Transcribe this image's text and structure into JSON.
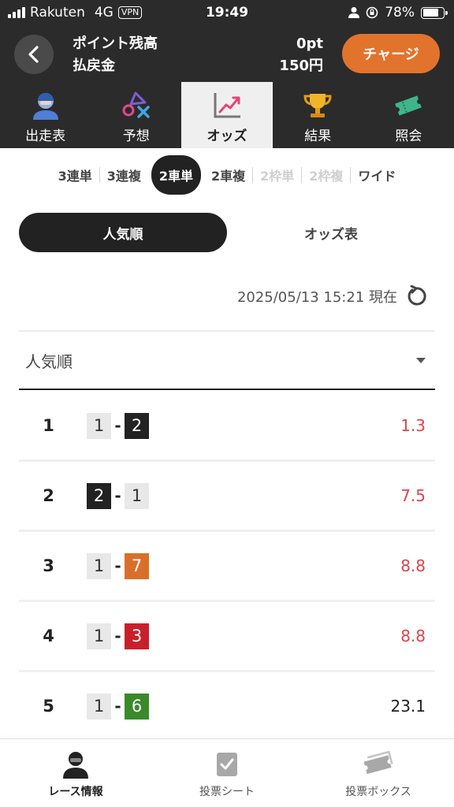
{
  "status_bar": {
    "carrier": "Rakuten",
    "network": "4G",
    "vpn": "VPN",
    "time": "19:49",
    "battery": "78%",
    "battery_level": 0.78
  },
  "header": {
    "point_label": "ポイント残高",
    "point_value": "0pt",
    "refund_label": "払戻金",
    "refund_value": "150円",
    "charge_button": "チャージ"
  },
  "main_tabs": [
    {
      "label": "出走表",
      "icon": "racer-icon",
      "active": false
    },
    {
      "label": "予想",
      "icon": "prediction-icon",
      "active": false
    },
    {
      "label": "オッズ",
      "icon": "odds-chart-icon",
      "active": true
    },
    {
      "label": "結果",
      "icon": "trophy-icon",
      "active": false
    },
    {
      "label": "照会",
      "icon": "ticket-icon",
      "active": false
    }
  ],
  "bet_types": [
    {
      "label": "3連単",
      "state": "normal"
    },
    {
      "label": "3連複",
      "state": "normal"
    },
    {
      "label": "2車単",
      "state": "active"
    },
    {
      "label": "2車複",
      "state": "normal"
    },
    {
      "label": "2枠単",
      "state": "disabled"
    },
    {
      "label": "2枠複",
      "state": "disabled"
    },
    {
      "label": "ワイド",
      "state": "normal"
    }
  ],
  "view_toggle": {
    "popularity": "人気順",
    "odds_table": "オッズ表",
    "active": "popularity"
  },
  "timestamp": "2025/05/13 15:21 現在",
  "sort_select": {
    "value": "人気順"
  },
  "colors": {
    "accent_orange": "#e2732c",
    "header_dark": "#2b2b2b",
    "odds_red": "#e0424a",
    "odds_normal": "#222222"
  },
  "odds_rows": [
    {
      "rank": "1",
      "first": {
        "num": "1",
        "bg": "#e8e8e8",
        "fg": "#333333"
      },
      "second": {
        "num": "2",
        "bg": "#222222",
        "fg": "#ffffff"
      },
      "odds": "1.3",
      "highlight": true
    },
    {
      "rank": "2",
      "first": {
        "num": "2",
        "bg": "#222222",
        "fg": "#ffffff"
      },
      "second": {
        "num": "1",
        "bg": "#e8e8e8",
        "fg": "#333333"
      },
      "odds": "7.5",
      "highlight": true
    },
    {
      "rank": "3",
      "first": {
        "num": "1",
        "bg": "#e8e8e8",
        "fg": "#333333"
      },
      "second": {
        "num": "7",
        "bg": "#d9702a",
        "fg": "#ffffff"
      },
      "odds": "8.8",
      "highlight": true
    },
    {
      "rank": "4",
      "first": {
        "num": "1",
        "bg": "#e8e8e8",
        "fg": "#333333"
      },
      "second": {
        "num": "3",
        "bg": "#c8202a",
        "fg": "#ffffff"
      },
      "odds": "8.8",
      "highlight": true
    },
    {
      "rank": "5",
      "first": {
        "num": "1",
        "bg": "#e8e8e8",
        "fg": "#333333"
      },
      "second": {
        "num": "6",
        "bg": "#3a8a2a",
        "fg": "#ffffff"
      },
      "odds": "23.1",
      "highlight": false
    }
  ],
  "bottom_nav": [
    {
      "label": "レース情報",
      "icon": "race-info-icon",
      "active": true
    },
    {
      "label": "投票シート",
      "icon": "vote-sheet-icon",
      "active": false
    },
    {
      "label": "投票ボックス",
      "icon": "vote-box-icon",
      "active": false
    }
  ]
}
